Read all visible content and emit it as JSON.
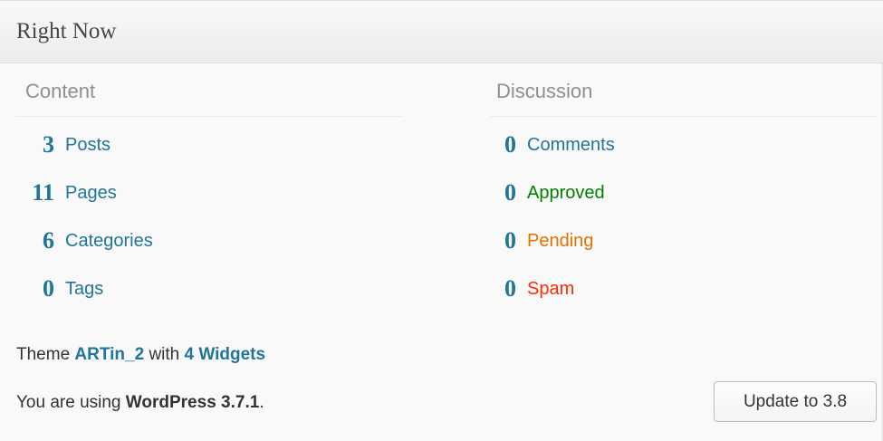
{
  "widget": {
    "title": "Right Now"
  },
  "content": {
    "heading": "Content",
    "items": [
      {
        "count": "3",
        "label": "Posts"
      },
      {
        "count": "11",
        "label": "Pages"
      },
      {
        "count": "6",
        "label": "Categories"
      },
      {
        "count": "0",
        "label": "Tags"
      }
    ]
  },
  "discussion": {
    "heading": "Discussion",
    "items": [
      {
        "count": "0",
        "label": "Comments",
        "color": "#21759b"
      },
      {
        "count": "0",
        "label": "Approved",
        "color": "#008000"
      },
      {
        "count": "0",
        "label": "Pending",
        "color": "#e66f00"
      },
      {
        "count": "0",
        "label": "Spam",
        "color": "#ff2b00"
      }
    ]
  },
  "theme": {
    "prefix": "Theme",
    "name": "ARTin_2",
    "middle": "with",
    "widgets_link": "4 Widgets"
  },
  "version": {
    "prefix": "You are using",
    "product": "WordPress 3.7.1",
    "suffix": "."
  },
  "update_button": {
    "label": "Update to 3.8"
  }
}
